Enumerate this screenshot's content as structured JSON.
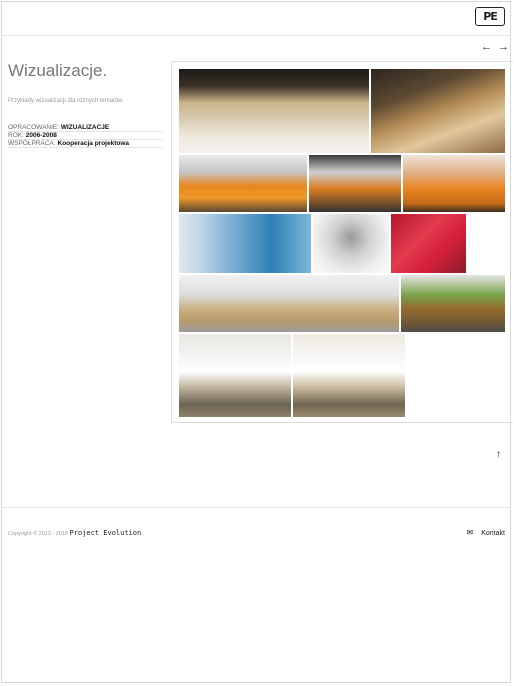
{
  "header": {
    "logo_text": "PE",
    "prev_icon": "←",
    "next_icon": "→"
  },
  "main": {
    "title": "Wizualizacje.",
    "subtitle": "Przykłady wizualizacji dla różnych tematów.",
    "meta": [
      {
        "label": "OPRACOWANIE:",
        "value": "WIZUALIZACJE"
      },
      {
        "label": "ROK:",
        "value": "2006-2008"
      },
      {
        "label": "WSPÓŁPRACA:",
        "value": "Kooperacja projektowa"
      }
    ]
  },
  "scroll_top_icon": "↑",
  "footer": {
    "copyright": "Copyright © 2013 - 2018",
    "brand": "Project Evolution",
    "contact_label": "Kontakt",
    "contact_icon": "✉"
  }
}
